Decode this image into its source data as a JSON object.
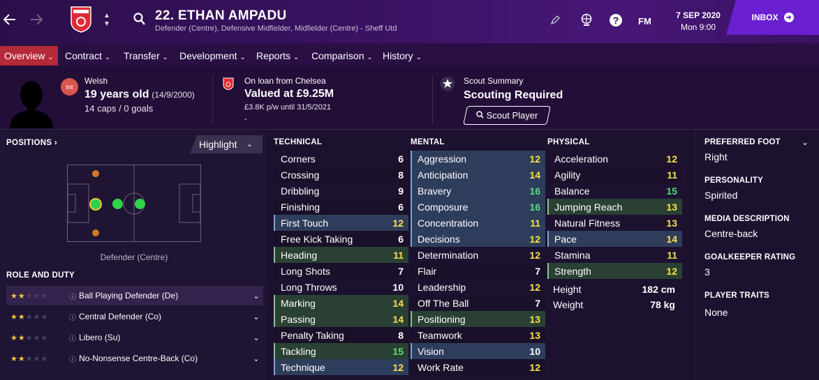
{
  "header": {
    "player_name": "22. ETHAN AMPADU",
    "player_subtitle": "Defender (Centre), Defensive Midfielder, Midfielder (Centre) - Sheff Utd",
    "fm_label": "FM",
    "date": "7 SEP 2020",
    "time": "Mon 9:00",
    "inbox_label": "INBOX",
    "brand_color": "#6a1fd1"
  },
  "tabs": [
    {
      "label": "Overview"
    },
    {
      "label": "Contract"
    },
    {
      "label": "Transfer"
    },
    {
      "label": "Development"
    },
    {
      "label": "Reports"
    },
    {
      "label": "Comparison"
    },
    {
      "label": "History"
    }
  ],
  "bio": {
    "int_badge": "Int",
    "nationality": "Welsh",
    "age": "19 years old",
    "dob": "(14/9/2000)",
    "caps": "14 caps / 0 goals"
  },
  "contract": {
    "loan": "On loan from Chelsea",
    "value": "Valued at £9.25M",
    "wage": "£3.8K p/w until 31/5/2021",
    "extra": "-"
  },
  "scout": {
    "title": "Scout Summary",
    "status": "Scouting Required",
    "button": "Scout Player"
  },
  "positions": {
    "header": "POSITIONS",
    "highlight": "Highlight",
    "current": "Defender (Centre)"
  },
  "roles": {
    "header": "ROLE AND DUTY",
    "items": [
      {
        "name": "Ball Playing Defender (De)",
        "stars": 2
      },
      {
        "name": "Central Defender (Co)",
        "stars": 2
      },
      {
        "name": "Libero (Su)",
        "stars": 2
      },
      {
        "name": "No-Nonsense Centre-Back (Co)",
        "stars": 2
      }
    ]
  },
  "technical": {
    "header": "TECHNICAL",
    "rows": [
      {
        "name": "Corners",
        "value": "6"
      },
      {
        "name": "Crossing",
        "value": "8"
      },
      {
        "name": "Dribbling",
        "value": "9"
      },
      {
        "name": "Finishing",
        "value": "6"
      },
      {
        "name": "First Touch",
        "value": "12",
        "hl": "hi"
      },
      {
        "name": "Free Kick Taking",
        "value": "6"
      },
      {
        "name": "Heading",
        "value": "11",
        "hl": "hi2"
      },
      {
        "name": "Long Shots",
        "value": "7"
      },
      {
        "name": "Long Throws",
        "value": "10"
      },
      {
        "name": "Marking",
        "value": "14",
        "hl": "hi2"
      },
      {
        "name": "Passing",
        "value": "14",
        "hl": "hi2"
      },
      {
        "name": "Penalty Taking",
        "value": "8"
      },
      {
        "name": "Tackling",
        "value": "15",
        "hl": "hi2"
      },
      {
        "name": "Technique",
        "value": "12",
        "hl": "hi"
      }
    ]
  },
  "mental": {
    "header": "MENTAL",
    "rows": [
      {
        "name": "Aggression",
        "value": "12",
        "hl": "hi"
      },
      {
        "name": "Anticipation",
        "value": "14",
        "hl": "hi"
      },
      {
        "name": "Bravery",
        "value": "16",
        "hl": "hi"
      },
      {
        "name": "Composure",
        "value": "16",
        "hl": "hi"
      },
      {
        "name": "Concentration",
        "value": "11",
        "hl": "hi"
      },
      {
        "name": "Decisions",
        "value": "12",
        "hl": "hi"
      },
      {
        "name": "Determination",
        "value": "12"
      },
      {
        "name": "Flair",
        "value": "7"
      },
      {
        "name": "Leadership",
        "value": "12"
      },
      {
        "name": "Off The Ball",
        "value": "7"
      },
      {
        "name": "Positioning",
        "value": "13",
        "hl": "hi2"
      },
      {
        "name": "Teamwork",
        "value": "13"
      },
      {
        "name": "Vision",
        "value": "10",
        "hl": "hi"
      },
      {
        "name": "Work Rate",
        "value": "12"
      }
    ]
  },
  "physical": {
    "header": "PHYSICAL",
    "rows": [
      {
        "name": "Acceleration",
        "value": "12"
      },
      {
        "name": "Agility",
        "value": "11"
      },
      {
        "name": "Balance",
        "value": "15"
      },
      {
        "name": "Jumping Reach",
        "value": "13",
        "hl": "hi2"
      },
      {
        "name": "Natural Fitness",
        "value": "13"
      },
      {
        "name": "Pace",
        "value": "14",
        "hl": "hi"
      },
      {
        "name": "Stamina",
        "value": "11"
      },
      {
        "name": "Strength",
        "value": "12",
        "hl": "hi2"
      }
    ],
    "height_label": "Height",
    "height": "182 cm",
    "weight_label": "Weight",
    "weight": "78 kg"
  },
  "details": {
    "preferred_foot_label": "PREFERRED FOOT",
    "preferred_foot": "Right",
    "personality_label": "PERSONALITY",
    "personality": "Spirited",
    "media_label": "MEDIA DESCRIPTION",
    "media": "Centre-back",
    "gk_label": "GOALKEEPER RATING",
    "gk": "3",
    "traits_label": "PLAYER TRAITS",
    "traits": "None"
  }
}
